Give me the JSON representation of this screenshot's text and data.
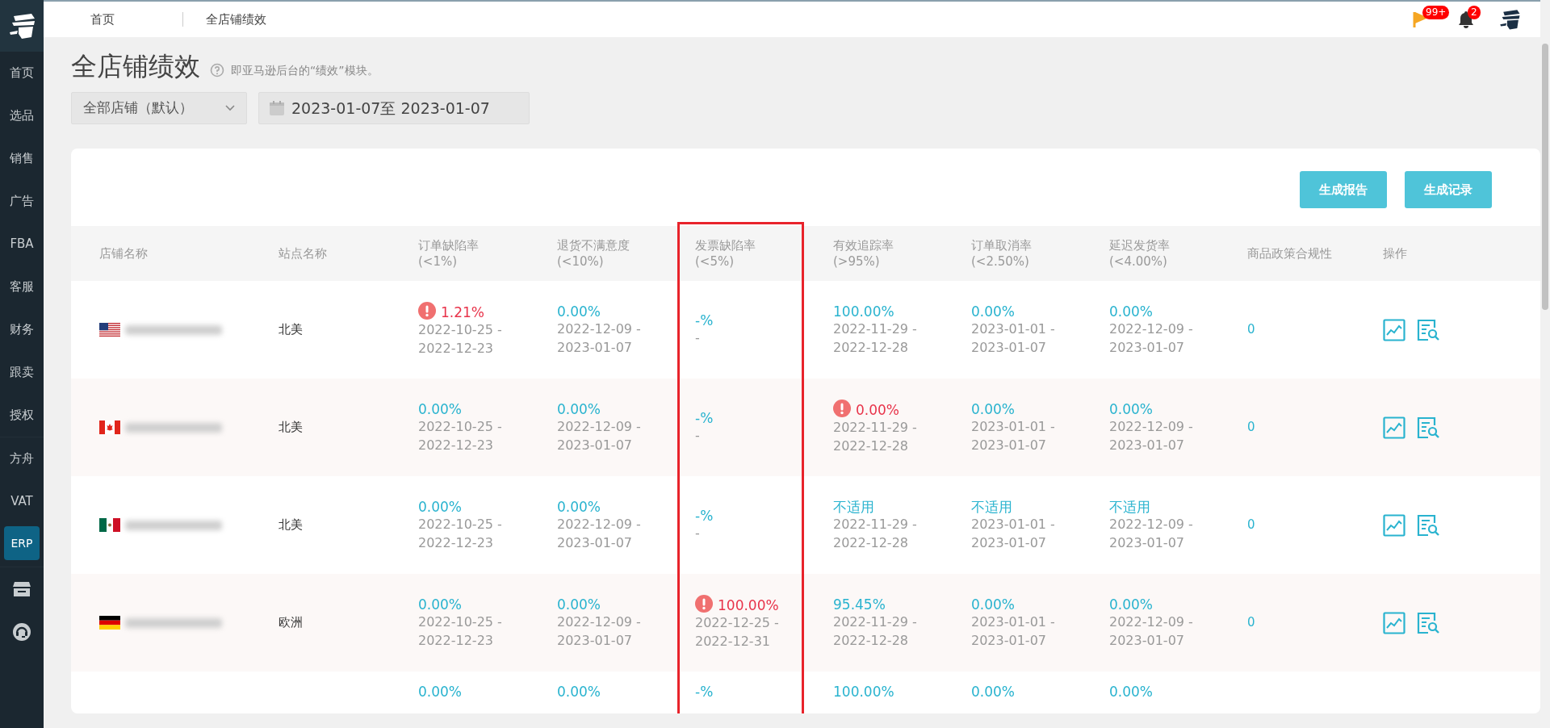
{
  "sidebar": {
    "sections": [
      {
        "items": [
          {
            "label": "首页",
            "selected": false
          },
          {
            "label": "选品",
            "selected": false
          },
          {
            "label": "销售",
            "selected": false
          },
          {
            "label": "广告",
            "selected": false
          },
          {
            "label": "FBA",
            "selected": false
          },
          {
            "label": "客服",
            "selected": false
          },
          {
            "label": "财务",
            "selected": false
          },
          {
            "label": "跟卖",
            "selected": false
          },
          {
            "label": "授权",
            "selected": false
          }
        ]
      },
      {
        "items": [
          {
            "label": "方舟",
            "selected": false
          },
          {
            "label": "VAT",
            "selected": false
          },
          {
            "label": "ERP",
            "selected": true
          }
        ]
      }
    ]
  },
  "breadcrumbs": [
    "首页",
    "全店铺绩效"
  ],
  "header": {
    "flag_badge": "99+",
    "bell_badge": "2"
  },
  "page": {
    "title": "全店铺绩效",
    "subtitle": "即亚马逊后台的“绩效”模块。"
  },
  "filters": {
    "store": "全部店铺（默认）",
    "date_range": "2023-01-07至 2023-01-07"
  },
  "buttons": [
    "生成报告",
    "生成记录"
  ],
  "table": {
    "columns": [
      {
        "title": "店铺名称"
      },
      {
        "title": "站点名称"
      },
      {
        "title": "订单缺陷率",
        "note": "(<1%)"
      },
      {
        "title": "退货不满意度",
        "note": "(<10%)"
      },
      {
        "title": "发票缺陷率",
        "note": "(<5%)",
        "highlighted": true
      },
      {
        "title": "有效追踪率",
        "note": "(>95%)"
      },
      {
        "title": "订单取消率",
        "note": "(<2.50%)"
      },
      {
        "title": "延迟发货率",
        "note": "(<4.00%)"
      },
      {
        "title": "商品政策合规性"
      },
      {
        "title": "操作"
      }
    ],
    "rows": [
      {
        "flag": {
          "kind": "us"
        },
        "site": "北美",
        "metrics": [
          {
            "value": "1.21%",
            "alert": true,
            "period": [
              "2022-10-25 -",
              "2022-12-23"
            ]
          },
          {
            "value": "0.00%",
            "alert": false,
            "period": [
              "2022-12-09 -",
              "2023-01-07"
            ]
          },
          {
            "value": "-%",
            "alert": false,
            "period": [
              "-"
            ]
          },
          {
            "value": "100.00%",
            "alert": false,
            "period": [
              "2022-11-29 -",
              "2022-12-28"
            ]
          },
          {
            "value": "0.00%",
            "alert": false,
            "period": [
              "2023-01-01 -",
              "2023-01-07"
            ]
          },
          {
            "value": "0.00%",
            "alert": false,
            "period": [
              "2022-12-09 -",
              "2023-01-07"
            ]
          }
        ],
        "compliance": "0"
      },
      {
        "flag": {
          "kind": "ca"
        },
        "site": "北美",
        "metrics": [
          {
            "value": "0.00%",
            "alert": false,
            "period": [
              "2022-10-25 -",
              "2022-12-23"
            ]
          },
          {
            "value": "0.00%",
            "alert": false,
            "period": [
              "2022-12-09 -",
              "2023-01-07"
            ]
          },
          {
            "value": "-%",
            "alert": false,
            "period": [
              "-"
            ]
          },
          {
            "value": "0.00%",
            "alert": true,
            "period": [
              "2022-11-29 -",
              "2022-12-28"
            ]
          },
          {
            "value": "0.00%",
            "alert": false,
            "period": [
              "2023-01-01 -",
              "2023-01-07"
            ]
          },
          {
            "value": "0.00%",
            "alert": false,
            "period": [
              "2022-12-09 -",
              "2023-01-07"
            ]
          }
        ],
        "compliance": "0"
      },
      {
        "flag": {
          "kind": "mx"
        },
        "site": "北美",
        "metrics": [
          {
            "value": "0.00%",
            "alert": false,
            "period": [
              "2022-10-25 -",
              "2022-12-23"
            ]
          },
          {
            "value": "0.00%",
            "alert": false,
            "period": [
              "2022-12-09 -",
              "2023-01-07"
            ]
          },
          {
            "value": "-%",
            "alert": false,
            "period": [
              "-"
            ]
          },
          {
            "value": "不适用",
            "alert": false,
            "period": [
              "2022-11-29 -",
              "2022-12-28"
            ]
          },
          {
            "value": "不适用",
            "alert": false,
            "period": [
              "2023-01-01 -",
              "2023-01-07"
            ]
          },
          {
            "value": "不适用",
            "alert": false,
            "period": [
              "2022-12-09 -",
              "2023-01-07"
            ]
          }
        ],
        "compliance": "0"
      },
      {
        "flag": {
          "kind": "de"
        },
        "site": "欧洲",
        "metrics": [
          {
            "value": "0.00%",
            "alert": false,
            "period": [
              "2022-10-25 -",
              "2022-12-23"
            ]
          },
          {
            "value": "0.00%",
            "alert": false,
            "period": [
              "2022-12-09 -",
              "2023-01-07"
            ]
          },
          {
            "value": "100.00%",
            "alert": true,
            "period": [
              "2022-12-25 -",
              "2022-12-31"
            ]
          },
          {
            "value": "95.45%",
            "alert": false,
            "period": [
              "2022-11-29 -",
              "2022-12-28"
            ]
          },
          {
            "value": "0.00%",
            "alert": false,
            "period": [
              "2023-01-01 -",
              "2023-01-07"
            ]
          },
          {
            "value": "0.00%",
            "alert": false,
            "period": [
              "2022-12-09 -",
              "2023-01-07"
            ]
          }
        ],
        "compliance": "0"
      },
      {
        "metrics": [
          {
            "value": "0.00%",
            "alert": false
          },
          {
            "value": "0.00%",
            "alert": false
          },
          {
            "value": "-%",
            "alert": false
          },
          {
            "value": "100.00%",
            "alert": false
          },
          {
            "value": "0.00%",
            "alert": false
          },
          {
            "value": "0.00%",
            "alert": false
          }
        ]
      }
    ]
  }
}
